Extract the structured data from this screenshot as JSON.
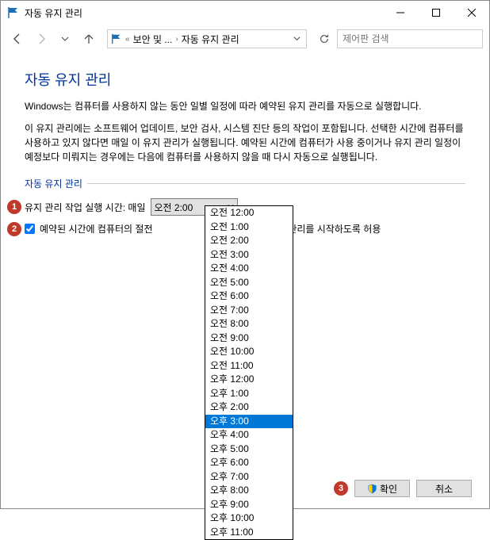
{
  "window": {
    "title": "자동 유지 관리"
  },
  "nav": {
    "crumb1": "보안 및 ...",
    "crumb2": "자동 유지 관리",
    "search_placeholder": "제어판 검색"
  },
  "page": {
    "heading": "자동 유지 관리",
    "p1": "Windows는 컴퓨터를 사용하지 않는 동안 일별 일정에 따라 예약된 유지 관리를 자동으로 실행합니다.",
    "p2": "이 유지 관리에는 소프트웨어 업데이트, 보안 검사, 시스템 진단 등의 작업이 포함됩니다. 선택한 시간에 컴퓨터를 사용하고 있지 않다면 매일 이 유지 관리가 실행됩니다. 예약된 시간에 컴퓨터가 사용 중이거나 유지 관리 일정이 예정보다 미뤄지는 경우에는 다음에 컴퓨터를 사용하지 않을 때 다시 자동으로 실행됩니다.",
    "section_label": "자동 유지 관리",
    "row1_label": "유지 관리 작업 실행 시간: 매일",
    "row1_value": "오전 2:00",
    "row2_label_before": "예약된 시간에 컴퓨터의 절전",
    "row2_label_after": "정된 유지 관리를 시작하도록 허용"
  },
  "dropdown": {
    "items": [
      "오전 12:00",
      "오전 1:00",
      "오전 2:00",
      "오전 3:00",
      "오전 4:00",
      "오전 5:00",
      "오전 6:00",
      "오전 7:00",
      "오전 8:00",
      "오전 9:00",
      "오전 10:00",
      "오전 11:00",
      "오후 12:00",
      "오후 1:00",
      "오후 2:00",
      "오후 3:00",
      "오후 4:00",
      "오후 5:00",
      "오후 6:00",
      "오후 7:00",
      "오후 8:00",
      "오후 9:00",
      "오후 10:00",
      "오후 11:00"
    ],
    "selected": "오후 3:00"
  },
  "annotations": {
    "a1": "1",
    "a2": "2",
    "a3": "3"
  },
  "footer": {
    "ok": "확인",
    "cancel": "취소"
  }
}
